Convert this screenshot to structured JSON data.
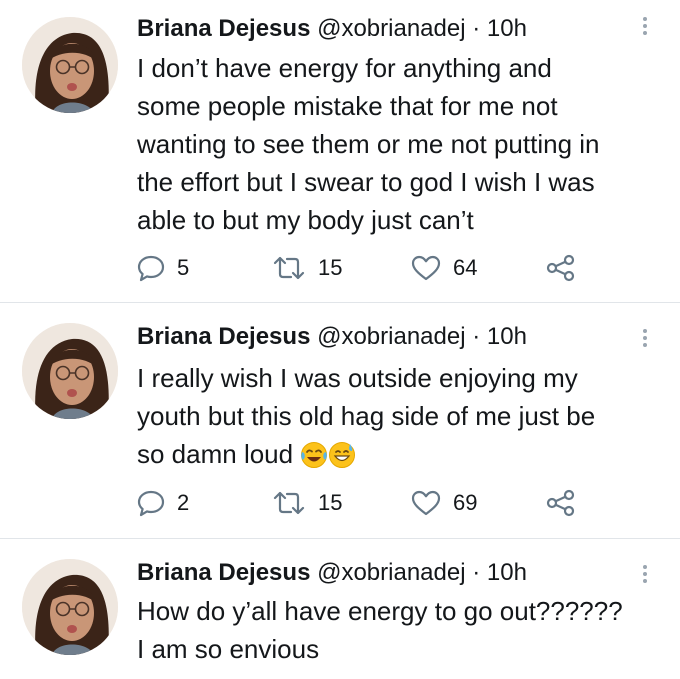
{
  "tweets": [
    {
      "name": "Briana Dejesus",
      "handle": "@xobrianadej",
      "time": "· 10h",
      "lines": [
        "I don’t have energy for anything and",
        "some people mistake that for me not",
        "wanting to see them or me not putting in",
        "the effort but I swear to god I wish I was",
        "able to but my body just can’t"
      ],
      "replies": "5",
      "retweets": "15",
      "likes": "64"
    },
    {
      "name": "Briana Dejesus",
      "handle": "@xobrianadej",
      "time": "· 10h",
      "lines": [
        "I really wish I was outside enjoying my",
        "youth but this old hag side of me just be",
        "so damn loud"
      ],
      "emojis": [
        "face-with-tears-of-joy",
        "grinning-face-with-sweat"
      ],
      "replies": "2",
      "retweets": "15",
      "likes": "69"
    },
    {
      "name": "Briana Dejesus",
      "handle": "@xobrianadej",
      "time": "· 10h",
      "lines": [
        "How do y’all have energy to go out??????",
        "I am so envious"
      ]
    }
  ],
  "colors": {
    "text": "#14171a",
    "icon": "#657786",
    "divider": "#e1e5e9"
  },
  "icons": [
    "reply-icon",
    "retweet-icon",
    "like-icon",
    "share-icon",
    "more-options-icon"
  ]
}
